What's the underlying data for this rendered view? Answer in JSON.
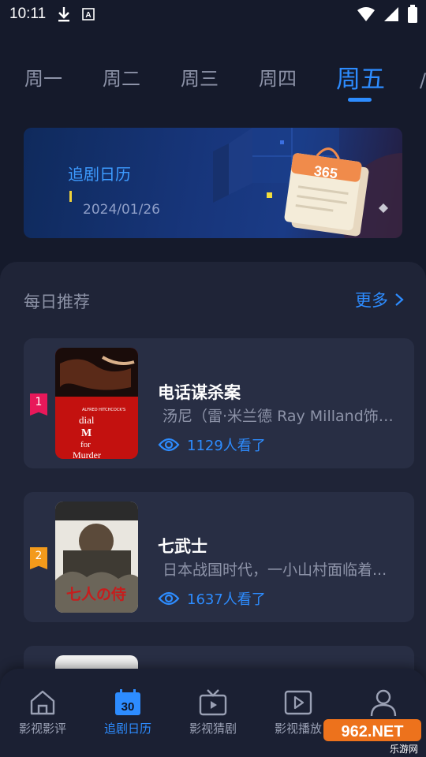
{
  "status_bar": {
    "time": "10:11",
    "icons": [
      "download-icon",
      "app-icon",
      "wifi-icon",
      "signal-icon",
      "battery-icon"
    ]
  },
  "tabs": [
    {
      "label": "周一",
      "active": false
    },
    {
      "label": "周二",
      "active": false
    },
    {
      "label": "周三",
      "active": false
    },
    {
      "label": "周四",
      "active": false
    },
    {
      "label": "周五",
      "active": true
    }
  ],
  "banner": {
    "title": "追剧日历",
    "date": "2024/01/26",
    "calendar_number": "365"
  },
  "recommend": {
    "title": "每日推荐",
    "more_label": "更多",
    "items": [
      {
        "rank": "1",
        "name": "电话谋杀案",
        "desc": "汤尼（雷·米兰德 Ray Milland饰）...",
        "views": "1129人看了",
        "poster_texts": [
          "ALFRED HITCHCOCK'S",
          "dial",
          "M",
          "for",
          "Murder"
        ]
      },
      {
        "rank": "2",
        "name": "七武士",
        "desc": "日本战国时代，一小山村面临着...",
        "views": "1637人看了",
        "poster_text": "七人の侍"
      }
    ]
  },
  "bottom_nav": [
    {
      "label": "影视影评",
      "icon": "home-icon",
      "active": false
    },
    {
      "label": "追剧日历",
      "icon": "calendar-icon",
      "icon_text": "30",
      "active": true
    },
    {
      "label": "影视猜剧",
      "icon": "tv-icon",
      "active": false
    },
    {
      "label": "影视播放",
      "icon": "play-icon",
      "active": false
    },
    {
      "label": "",
      "icon": "user-icon",
      "active": false
    }
  ],
  "watermark": {
    "logo": "962.NET",
    "sub": "乐游网"
  },
  "colors": {
    "accent": "#2d8cff",
    "background": "#151a2b",
    "card": "#282e44",
    "rank1": "#e8185a",
    "rank2": "#f39a1b"
  }
}
